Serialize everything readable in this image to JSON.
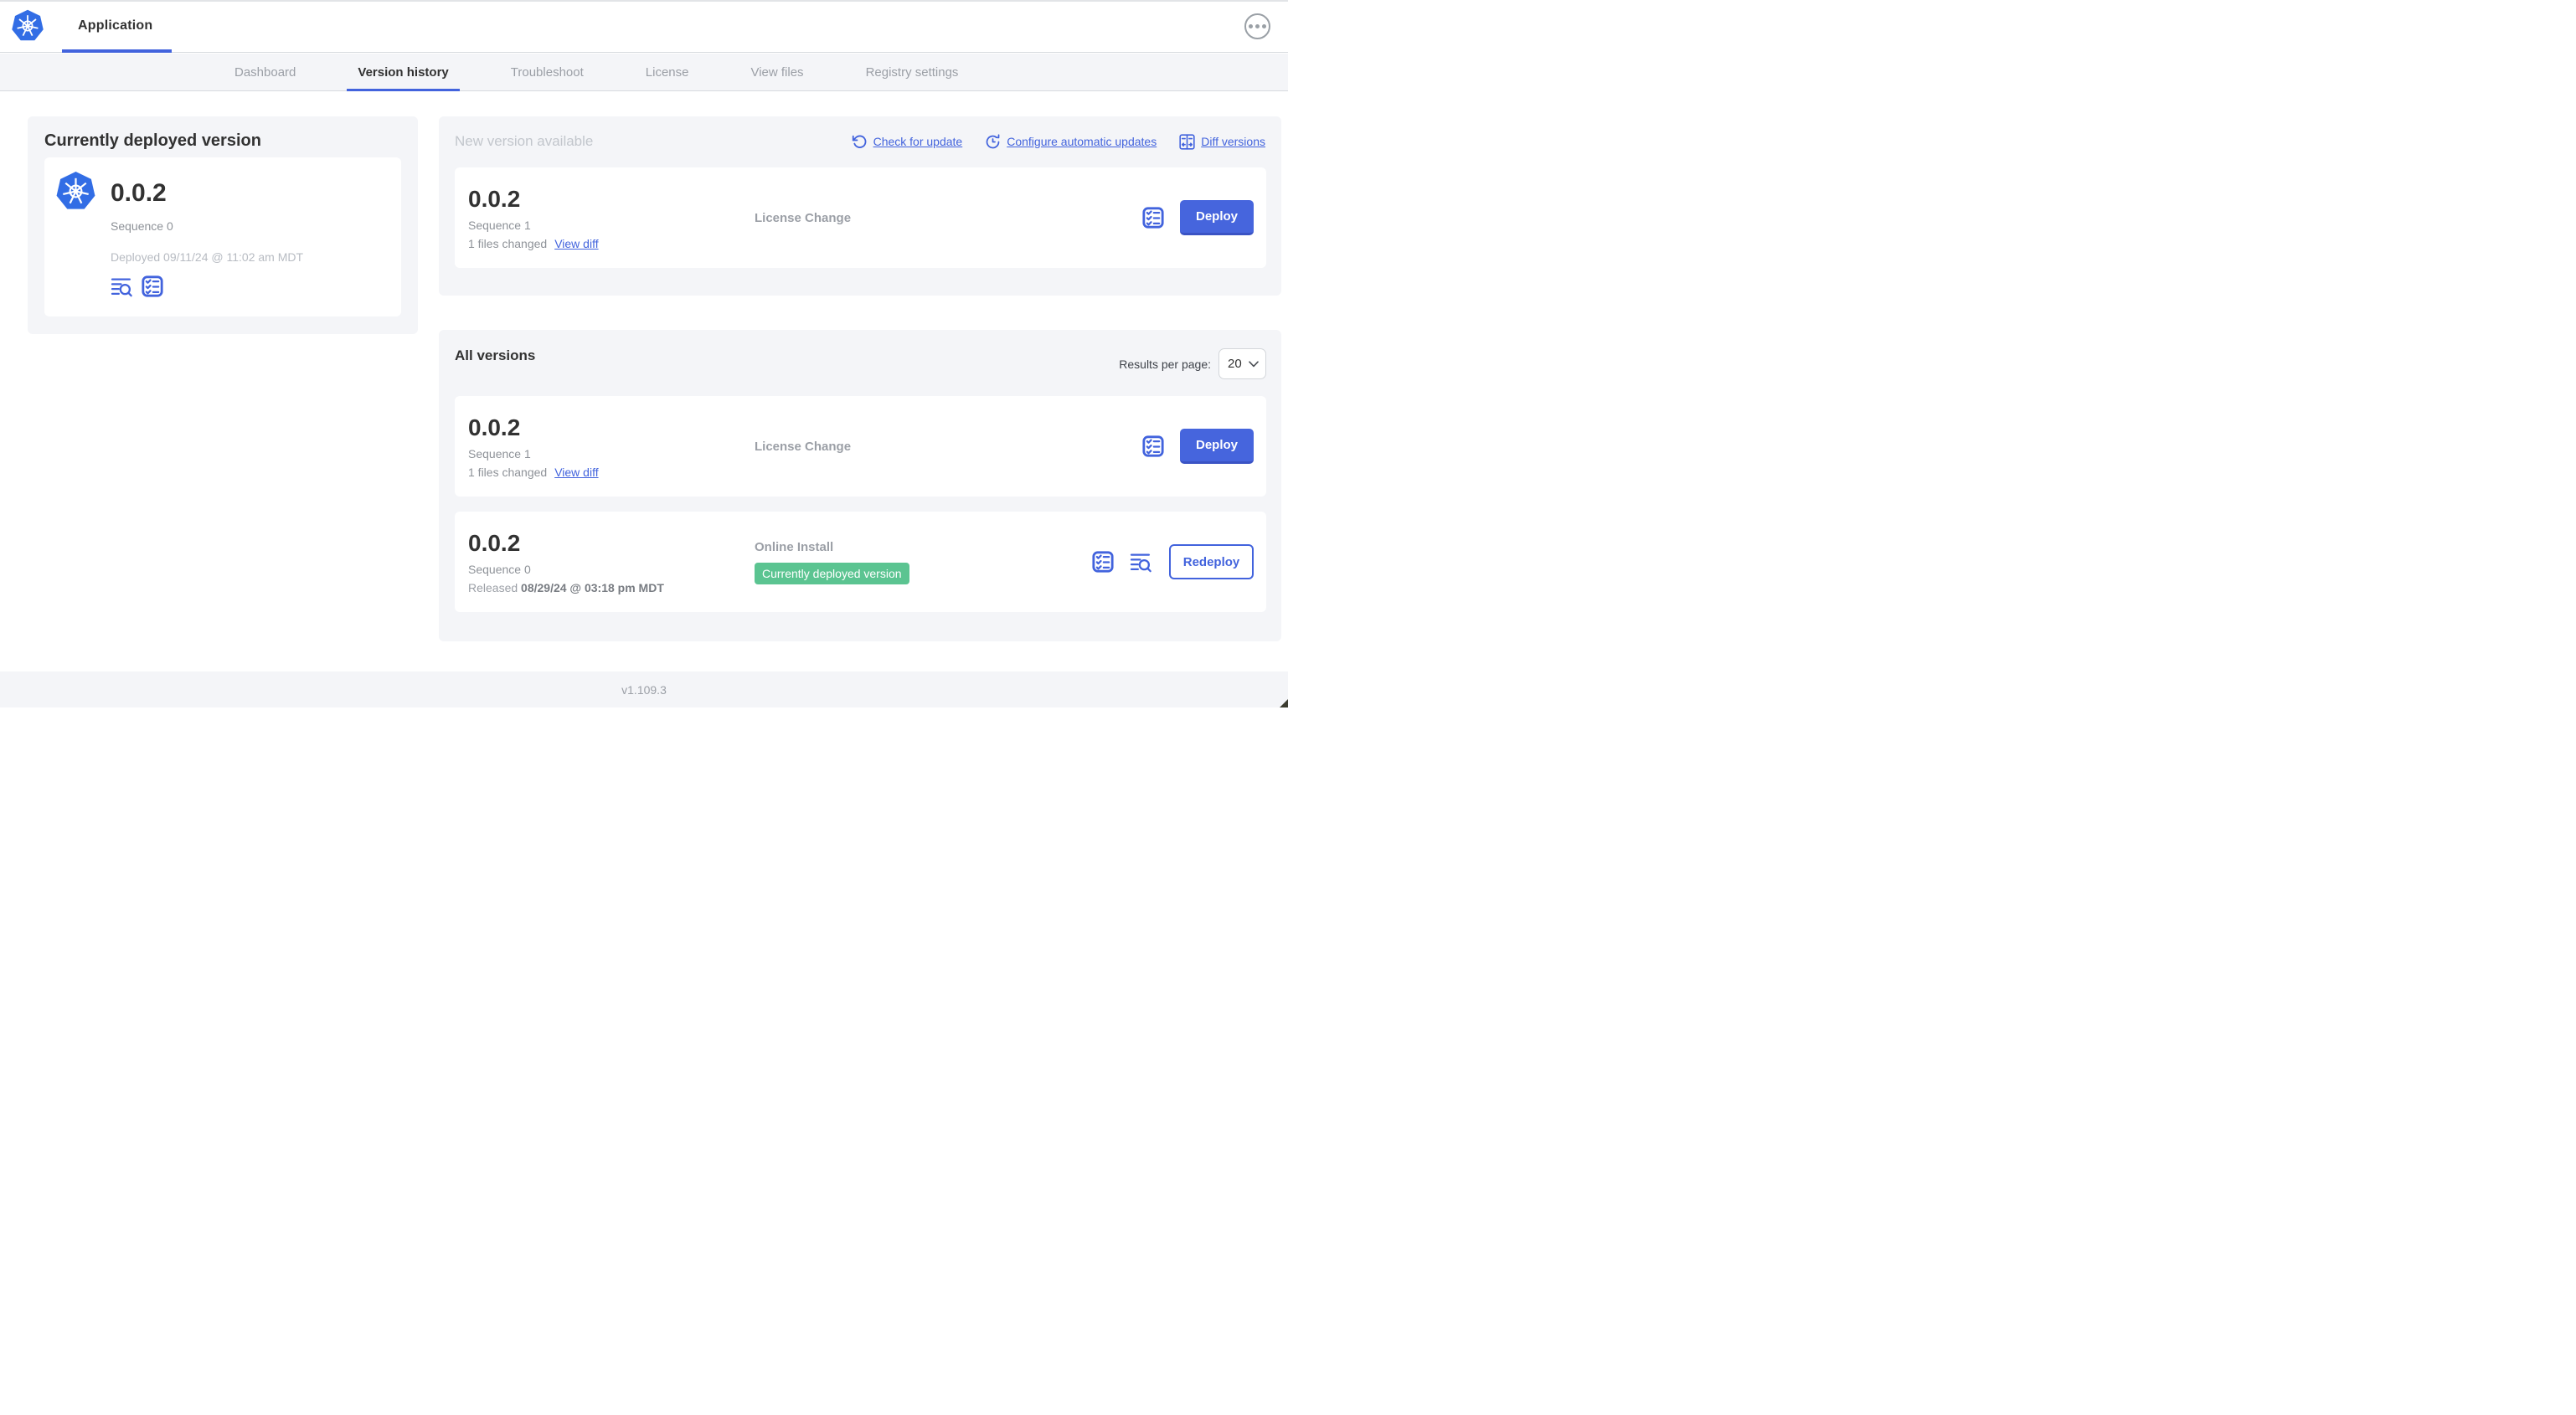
{
  "colors": {
    "accent": "#4263dd",
    "accent_dark": "#3a53c4",
    "kubernetes_blue": "#326de5",
    "badge_green": "#5bc491",
    "panel_bg": "#f4f5f8",
    "border": "#d7dade",
    "text_dark": "#323232",
    "text_gray": "#9b9fa6",
    "text_light": "#b7bbc2"
  },
  "header": {
    "app_title": "Application",
    "logo_icon": "kubernetes-logo",
    "menu_icon": "ellipsis-icon"
  },
  "nav": {
    "tabs": [
      {
        "label": "Dashboard",
        "active": false
      },
      {
        "label": "Version history",
        "active": true
      },
      {
        "label": "Troubleshoot",
        "active": false
      },
      {
        "label": "License",
        "active": false
      },
      {
        "label": "View files",
        "active": false
      },
      {
        "label": "Registry settings",
        "active": false
      }
    ]
  },
  "current_version_panel": {
    "title": "Currently deployed version",
    "version": "0.0.2",
    "sequence": "Sequence 0",
    "deployed": "Deployed 09/11/24 @ 11:02 am MDT",
    "icons": [
      "logs-icon",
      "checklist-icon"
    ]
  },
  "new_version_panel": {
    "title": "New version available",
    "links": [
      {
        "label": "Check for update",
        "icon": "refresh-icon"
      },
      {
        "label": "Configure automatic updates",
        "icon": "schedule-icon"
      },
      {
        "label": "Diff versions",
        "icon": "diff-icon"
      }
    ],
    "card": {
      "version": "0.0.2",
      "sequence": "Sequence 1",
      "files_changed": "1 files changed",
      "view_diff_label": "View diff",
      "source": "License Change",
      "deploy_label": "Deploy"
    }
  },
  "all_versions_panel": {
    "title": "All versions",
    "results_per_page_label": "Results per page:",
    "results_per_page_value": "20",
    "rows": [
      {
        "version": "0.0.2",
        "sequence": "Sequence 1",
        "files_changed": "1 files changed",
        "view_diff_label": "View diff",
        "source": "License Change",
        "action_label": "Deploy"
      },
      {
        "version": "0.0.2",
        "sequence": "Sequence 0",
        "released_prefix": "Released ",
        "released_date": "08/29/24 @ 03:18 pm MDT",
        "source": "Online Install",
        "badge": "Currently deployed version",
        "action_label": "Redeploy"
      }
    ]
  },
  "footer": {
    "app_manager_version": "v1.109.3"
  }
}
